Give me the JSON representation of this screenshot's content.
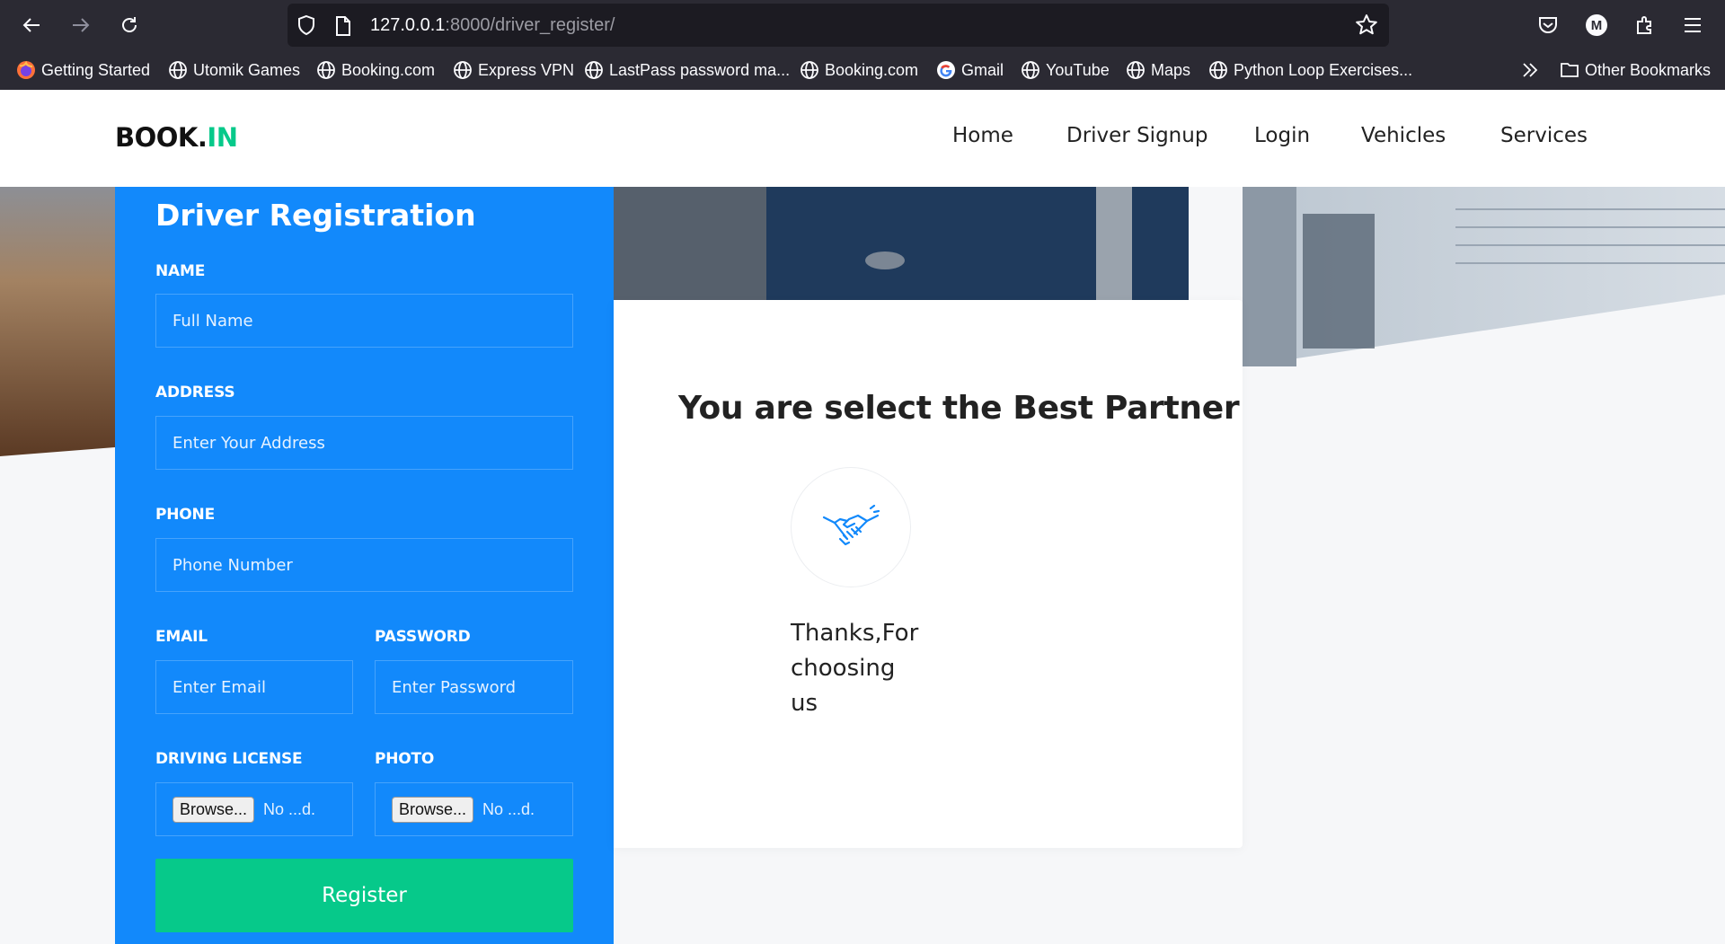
{
  "browser": {
    "url_host": "127.0.0.1",
    "url_rest": ":8000/driver_register/",
    "profile_initial": "M",
    "bookmarks": [
      {
        "label": "Getting Started",
        "icon": "firefox-icon"
      },
      {
        "label": "Utomik Games",
        "icon": "globe-icon"
      },
      {
        "label": "Booking.com",
        "icon": "globe-icon"
      },
      {
        "label": "Express VPN",
        "icon": "globe-icon"
      },
      {
        "label": "LastPass password ma...",
        "icon": "globe-icon"
      },
      {
        "label": "Booking.com",
        "icon": "globe-icon"
      },
      {
        "label": "Gmail",
        "icon": "google-icon"
      },
      {
        "label": "YouTube",
        "icon": "globe-icon"
      },
      {
        "label": "Maps",
        "icon": "globe-icon"
      },
      {
        "label": "Python Loop Exercises...",
        "icon": "globe-icon"
      }
    ],
    "other_bookmarks": "Other Bookmarks"
  },
  "site": {
    "logo_main": "BOOK.",
    "logo_accent": "IN",
    "menu": [
      "Home",
      "Driver Signup",
      "Login",
      "Vehicles",
      "Services"
    ]
  },
  "form": {
    "title": "Driver Registration",
    "name_label": "NAME",
    "name_placeholder": "Full Name",
    "address_label": "ADDRESS",
    "address_placeholder": "Enter Your Address",
    "phone_label": "PHONE",
    "phone_placeholder": "Phone Number",
    "email_label": "EMAIL",
    "email_placeholder": "Enter Email",
    "password_label": "PASSWORD",
    "password_placeholder": "Enter Password",
    "license_label": "DRIVING LICENSE",
    "photo_label": "PHOTO",
    "browse_label": "Browse...",
    "no_file_text": "No ...d.",
    "register_label": "Register"
  },
  "card": {
    "title": "You are select the Best Partner",
    "icon": "handshake-icon",
    "thanks": "Thanks,For choosing us"
  },
  "colors": {
    "form_blue": "#1289fb",
    "accent_green": "#06c98a",
    "chrome_dark": "#2b2a33"
  }
}
